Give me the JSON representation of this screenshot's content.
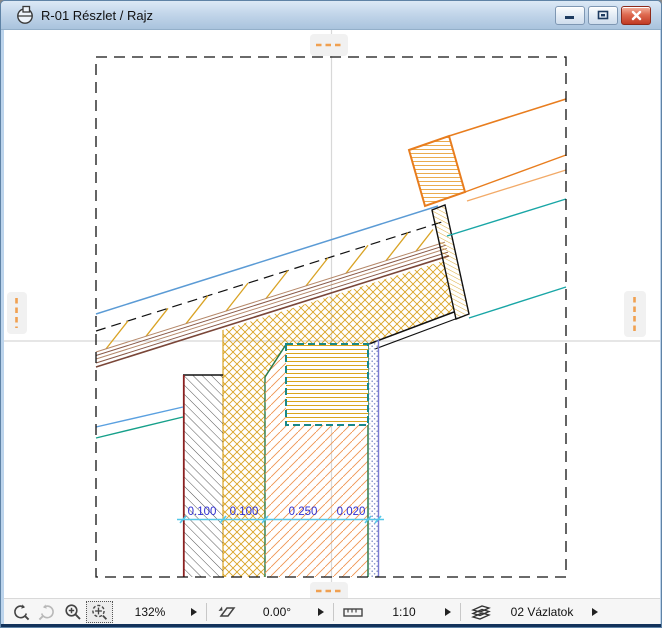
{
  "window": {
    "title": "R-01 Részlet / Rajz"
  },
  "titlebar_icons": {
    "app_icon": "detail-marker-circle",
    "minimize": "minimize-dash",
    "restore": "restore-box",
    "close": "close-x"
  },
  "statusbar": {
    "zoom_back_icon": "zoom-back-arrow",
    "zoom_forward_icon": "zoom-forward-arrow",
    "zoom_in_icon": "magnifier-plus",
    "fit_icon": "fit-in-window-magnifier",
    "zoom_value": "132%",
    "rotate_icon": "rotation-diamond",
    "rotation_value": "0.00°",
    "scale_icon": "scale-ruler",
    "scale_value": "1:10",
    "layers_icon": "layers-stack",
    "layer_value": "02 Vázlatok"
  },
  "drawing": {
    "dimension_labels": [
      "0.100",
      "0.100",
      "0.250",
      "0.020"
    ]
  },
  "colors": {
    "hatch_gold": "#d9a324",
    "strong_orange": "#e87d1e",
    "light_orange": "#f2aa68",
    "teal": "#19a6a6",
    "roof_blue": "#5b9bd5",
    "wall_green": "#2a7a4a",
    "beam_teal": "#188888",
    "dark_red": "#8a2020",
    "brown_dark": "#7a4638",
    "brown_light": "#b5886a",
    "dimension_text_blue": "#2f2fd0",
    "dimension_line_cyan": "#55c8e8",
    "guide_gray": "#d8d8d8",
    "marker_orange": "#f0a050"
  }
}
